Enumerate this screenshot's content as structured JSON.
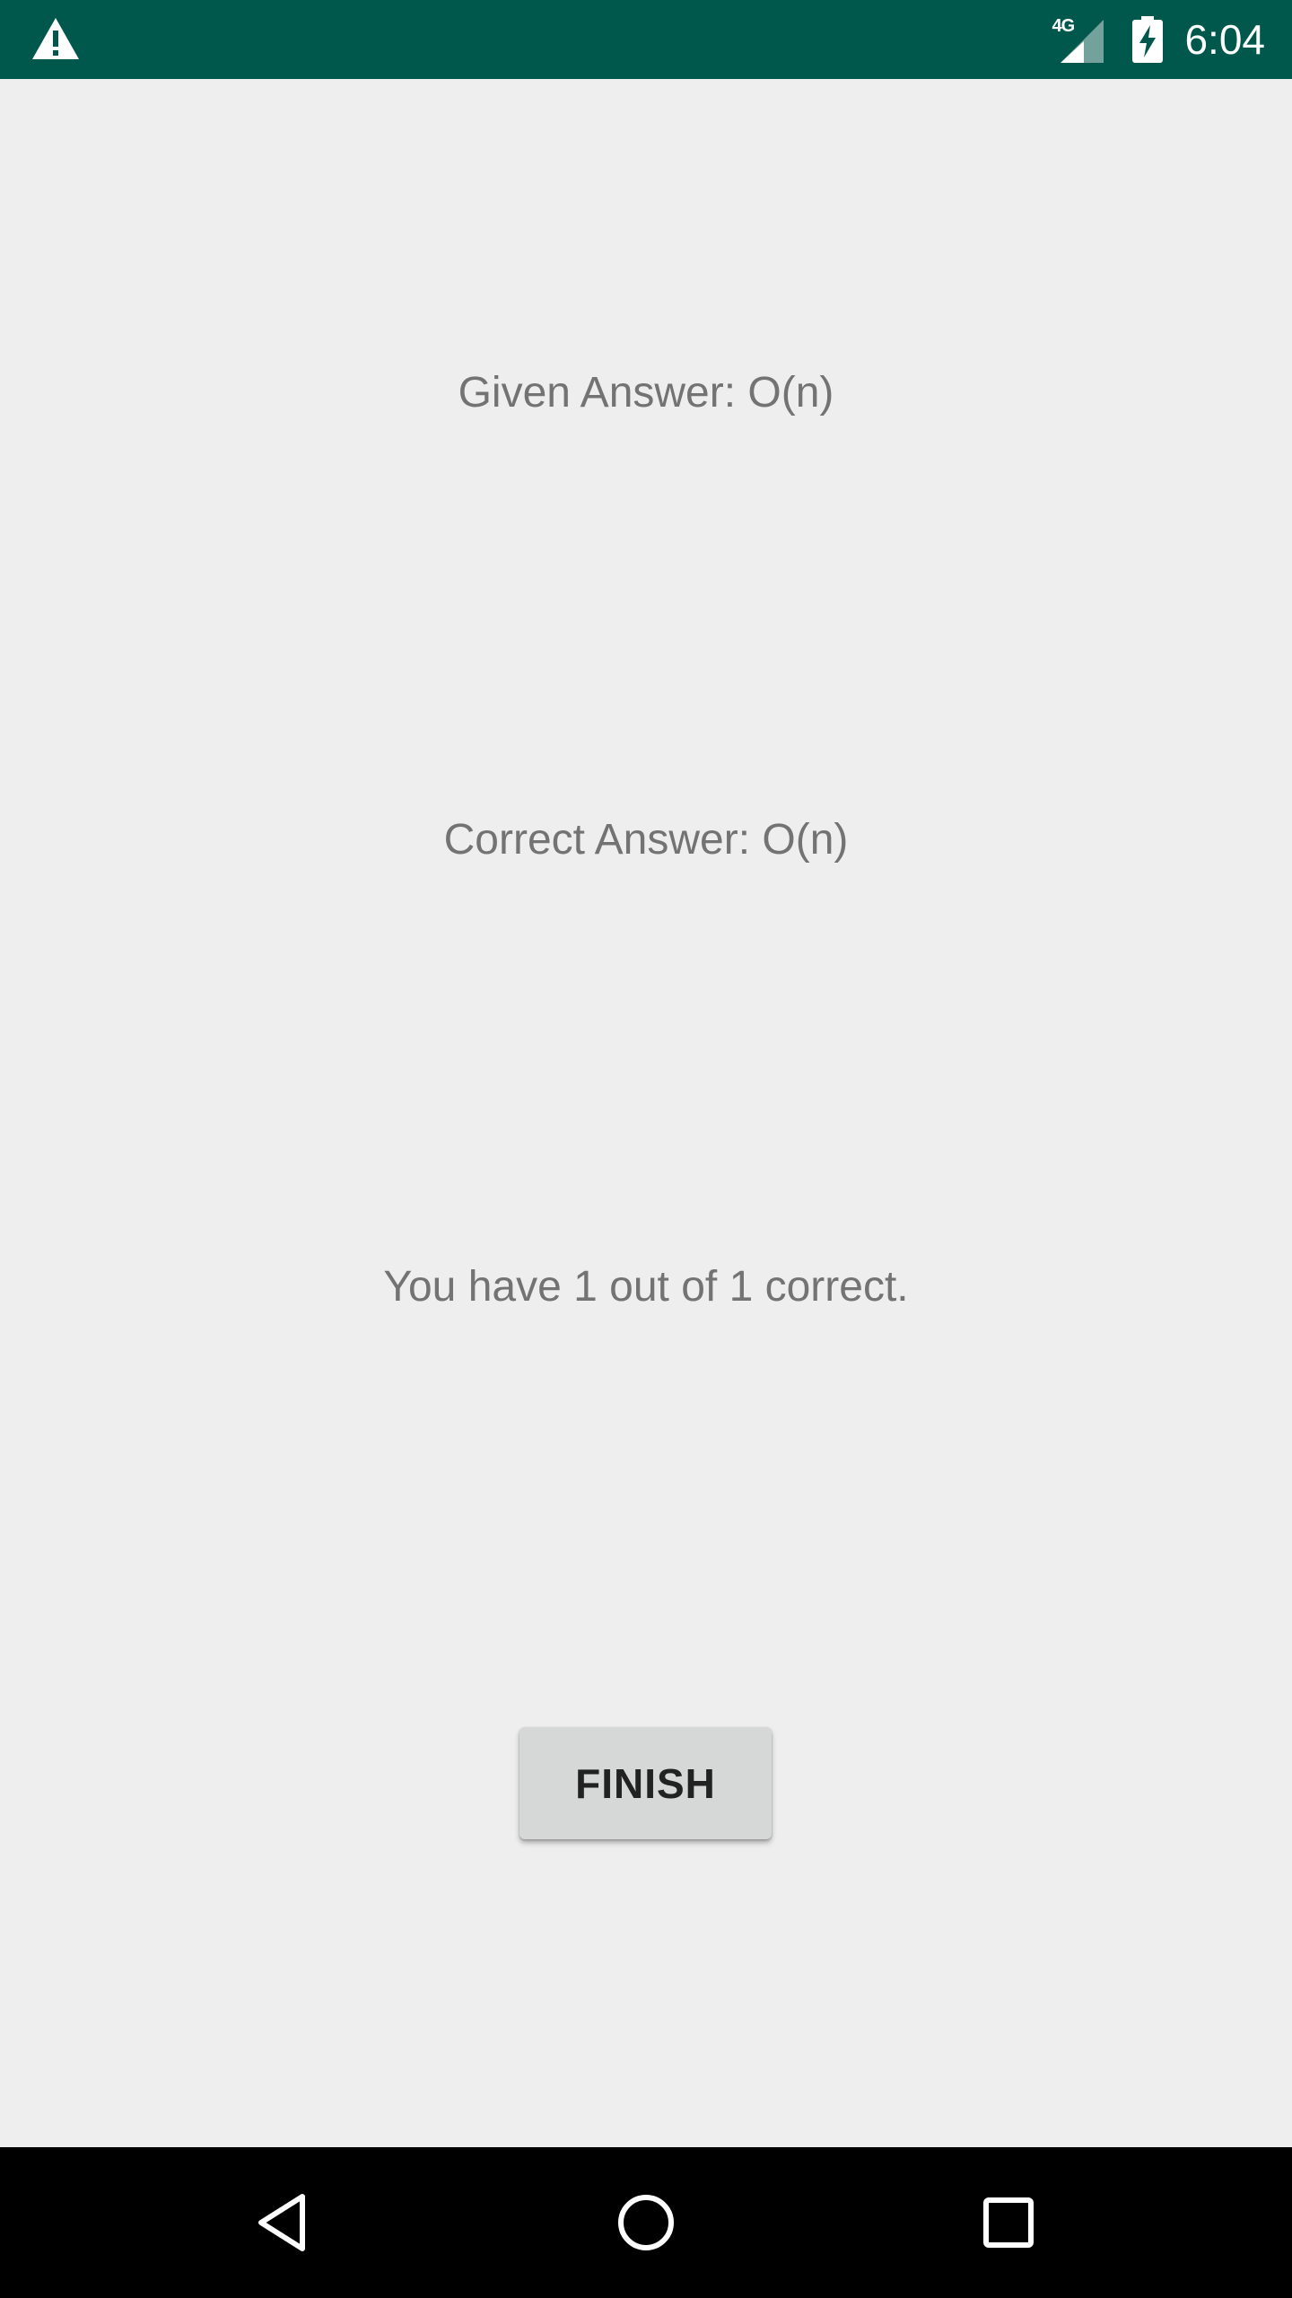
{
  "status_bar": {
    "network_type": "4G",
    "time": "6:04",
    "icons": [
      "warning-icon",
      "signal-4g-icon",
      "battery-charging-icon"
    ]
  },
  "results": {
    "given_answer": "Given Answer: O(n)",
    "correct_answer": "Correct Answer: O(n)",
    "score": "You have 1 out of 1 correct."
  },
  "actions": {
    "finish_label": "FINISH"
  },
  "navigation": {
    "icons": [
      "back-icon",
      "home-icon",
      "recents-icon"
    ]
  },
  "colors": {
    "status_bar": "#00574b",
    "background": "#eeeeee",
    "text": "#737373",
    "button": "#d6d7d7",
    "nav_bar": "#000000"
  }
}
